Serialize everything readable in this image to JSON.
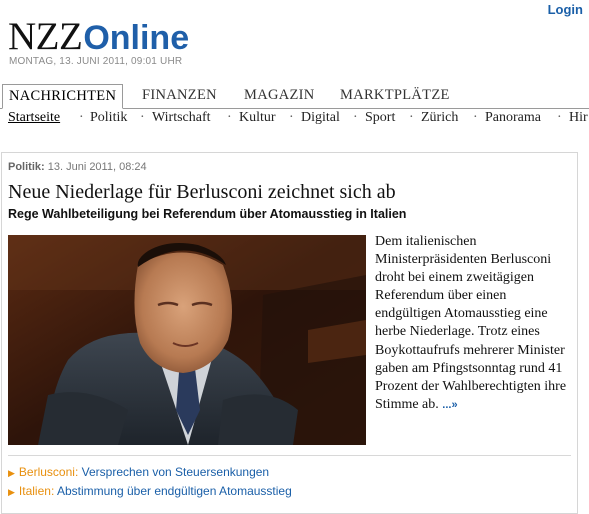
{
  "header": {
    "login_label": "Login",
    "logo_part1": "NZZ",
    "logo_part2": "Online",
    "date": "MONTAG, 13. JUNI 2011, 09:01 UHR"
  },
  "tabs": [
    {
      "label": "NACHRICHTEN",
      "active": true
    },
    {
      "label": "FINANZEN",
      "active": false
    },
    {
      "label": "MAGAZIN",
      "active": false
    },
    {
      "label": "MARKTPLÄTZE",
      "active": false
    }
  ],
  "subnav": [
    "Startseite",
    "Politik",
    "Wirtschaft",
    "Kultur",
    "Digital",
    "Sport",
    "Zürich",
    "Panorama",
    "Hir"
  ],
  "subnav_separator": "·",
  "article": {
    "section": "Politik:",
    "timestamp": "13. Juni 2011, 08:24",
    "headline": "Neue Niederlage für Berlusconi zeichnet sich ab",
    "lead": "Rege Wahlbeteiligung bei Referendum über Atomausstieg in Italien",
    "body": "Dem italienischen Ministerpräsidenten Berlusconi droht bei einem zweitägigen Referendum über einen endgültigen Atomausstieg eine herbe Niederlage. Trotz eines Boykottaufrufs mehrerer Minister gaben am Pfingstsonntag rund 41 Prozent der Wahlberechtigten ihre Stimme ab.",
    "more_label": "...»",
    "photo_icon": "portrait-photo"
  },
  "related": [
    {
      "kicker": "Berlusconi:",
      "title": "Versprechen von Steuersenkungen"
    },
    {
      "kicker": "Italien:",
      "title": "Abstimmung über endgültigen Atomausstieg"
    }
  ],
  "colors": {
    "brand_blue": "#1f5fa9",
    "link_blue": "#1a5fa8",
    "accent_orange": "#e8900f"
  }
}
